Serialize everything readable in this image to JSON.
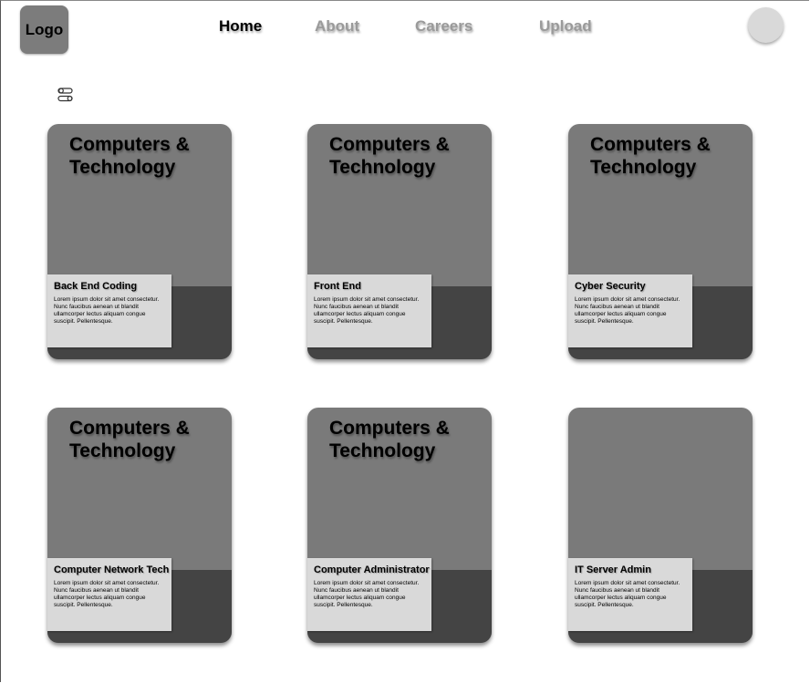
{
  "header": {
    "logo": "Logo",
    "nav": [
      {
        "label": "Home"
      },
      {
        "label": "About"
      },
      {
        "label": "Careers"
      },
      {
        "label": "Upload"
      }
    ]
  },
  "icons": {
    "filter": "filter-sliders-icon",
    "avatar": "user-avatar"
  },
  "colors": {
    "card_top": "#7a7a7a",
    "card_bottom": "#444444",
    "info_panel": "#d9d9d9",
    "nav_active": "#000000",
    "nav_inactive": "#9a9a9a"
  },
  "cards": [
    {
      "heading": "Computers & Technology",
      "title": "Back End Coding",
      "text": "Lorem ipsum dolor sit amet consectetur. Nunc faucibus aenean ut blandit ullamcorper lectus aliquam congue suscipit. Pellentesque."
    },
    {
      "heading": "Computers & Technology",
      "title": "Front End",
      "text": "Lorem ipsum dolor sit amet consectetur. Nunc faucibus aenean ut blandit ullamcorper lectus aliquam congue suscipit. Pellentesque."
    },
    {
      "heading": "Computers & Technology",
      "title": "Cyber Security",
      "text": "Lorem ipsum dolor sit amet consectetur. Nunc faucibus aenean ut blandit ullamcorper lectus aliquam congue suscipit. Pellentesque."
    },
    {
      "heading": "Computers & Technology",
      "title": "Computer Network Tech",
      "text": "Lorem ipsum dolor sit amet consectetur. Nunc faucibus aenean ut blandit ullamcorper lectus aliquam congue suscipit. Pellentesque."
    },
    {
      "heading": "Computers & Technology",
      "title": "Computer Administrator",
      "text": "Lorem ipsum dolor sit amet consectetur. Nunc faucibus aenean ut blandit ullamcorper lectus aliquam congue suscipit. Pellentesque."
    },
    {
      "heading": "",
      "title": "IT Server Admin",
      "text": "Lorem ipsum dolor sit amet consectetur. Nunc faucibus aenean ut blandit ullamcorper lectus aliquam congue suscipit. Pellentesque."
    }
  ]
}
